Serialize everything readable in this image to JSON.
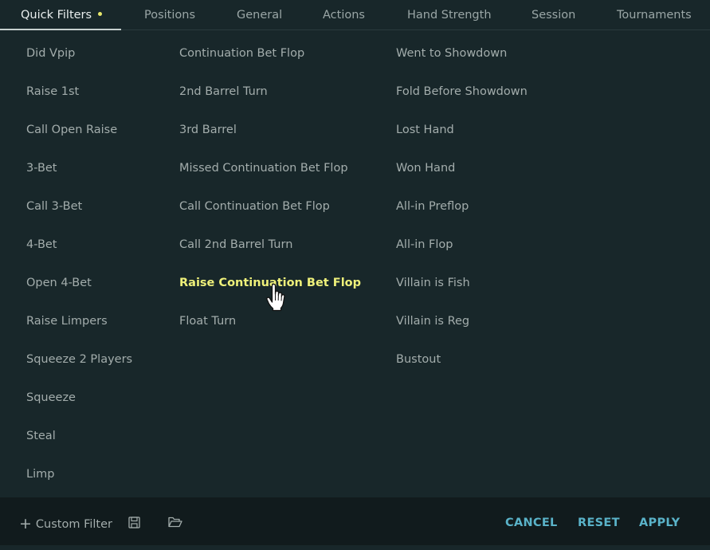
{
  "tabs": [
    {
      "label": "Quick Filters"
    },
    {
      "label": "Positions"
    },
    {
      "label": "General"
    },
    {
      "label": "Actions"
    },
    {
      "label": "Hand Strength"
    },
    {
      "label": "Session"
    },
    {
      "label": "Tournaments"
    }
  ],
  "active_tab": "Quick Filters",
  "columns": [
    [
      "Did Vpip",
      "Raise 1st",
      "Call Open Raise",
      "3-Bet",
      "Call 3-Bet",
      "4-Bet",
      "Open 4-Bet",
      "Raise Limpers",
      "Squeeze 2 Players",
      "Squeeze",
      "Steal",
      "Limp"
    ],
    [
      "Continuation Bet Flop",
      "2nd Barrel Turn",
      "3rd Barrel",
      "Missed Continuation Bet Flop",
      "Call Continuation Bet Flop",
      "Call 2nd Barrel Turn",
      "Raise Continuation Bet Flop",
      "Float Turn"
    ],
    [
      "Went to Showdown",
      "Fold Before Showdown",
      "Lost Hand",
      "Won Hand",
      "All-in Preflop",
      "All-in Flop",
      "Villain is Fish",
      "Villain is Reg",
      "Bustout"
    ]
  ],
  "highlighted_item": "Raise Continuation Bet Flop",
  "footer": {
    "custom_filter_label": "Custom Filter",
    "plus_glyph": "+",
    "cancel_label": "CANCEL",
    "reset_label": "RESET",
    "apply_label": "APPLY"
  },
  "colors": {
    "background": "#18272a",
    "footer_background": "#111b1d",
    "text": "#a3adac",
    "active_tab_text": "#e9eeee",
    "highlight": "#eef07a",
    "accent": "#5ab3c9",
    "dot": "#e6e76b"
  },
  "icons": {
    "save": "floppy-disk-icon",
    "open": "folder-open-icon",
    "cursor": "hand-pointer-cursor"
  }
}
